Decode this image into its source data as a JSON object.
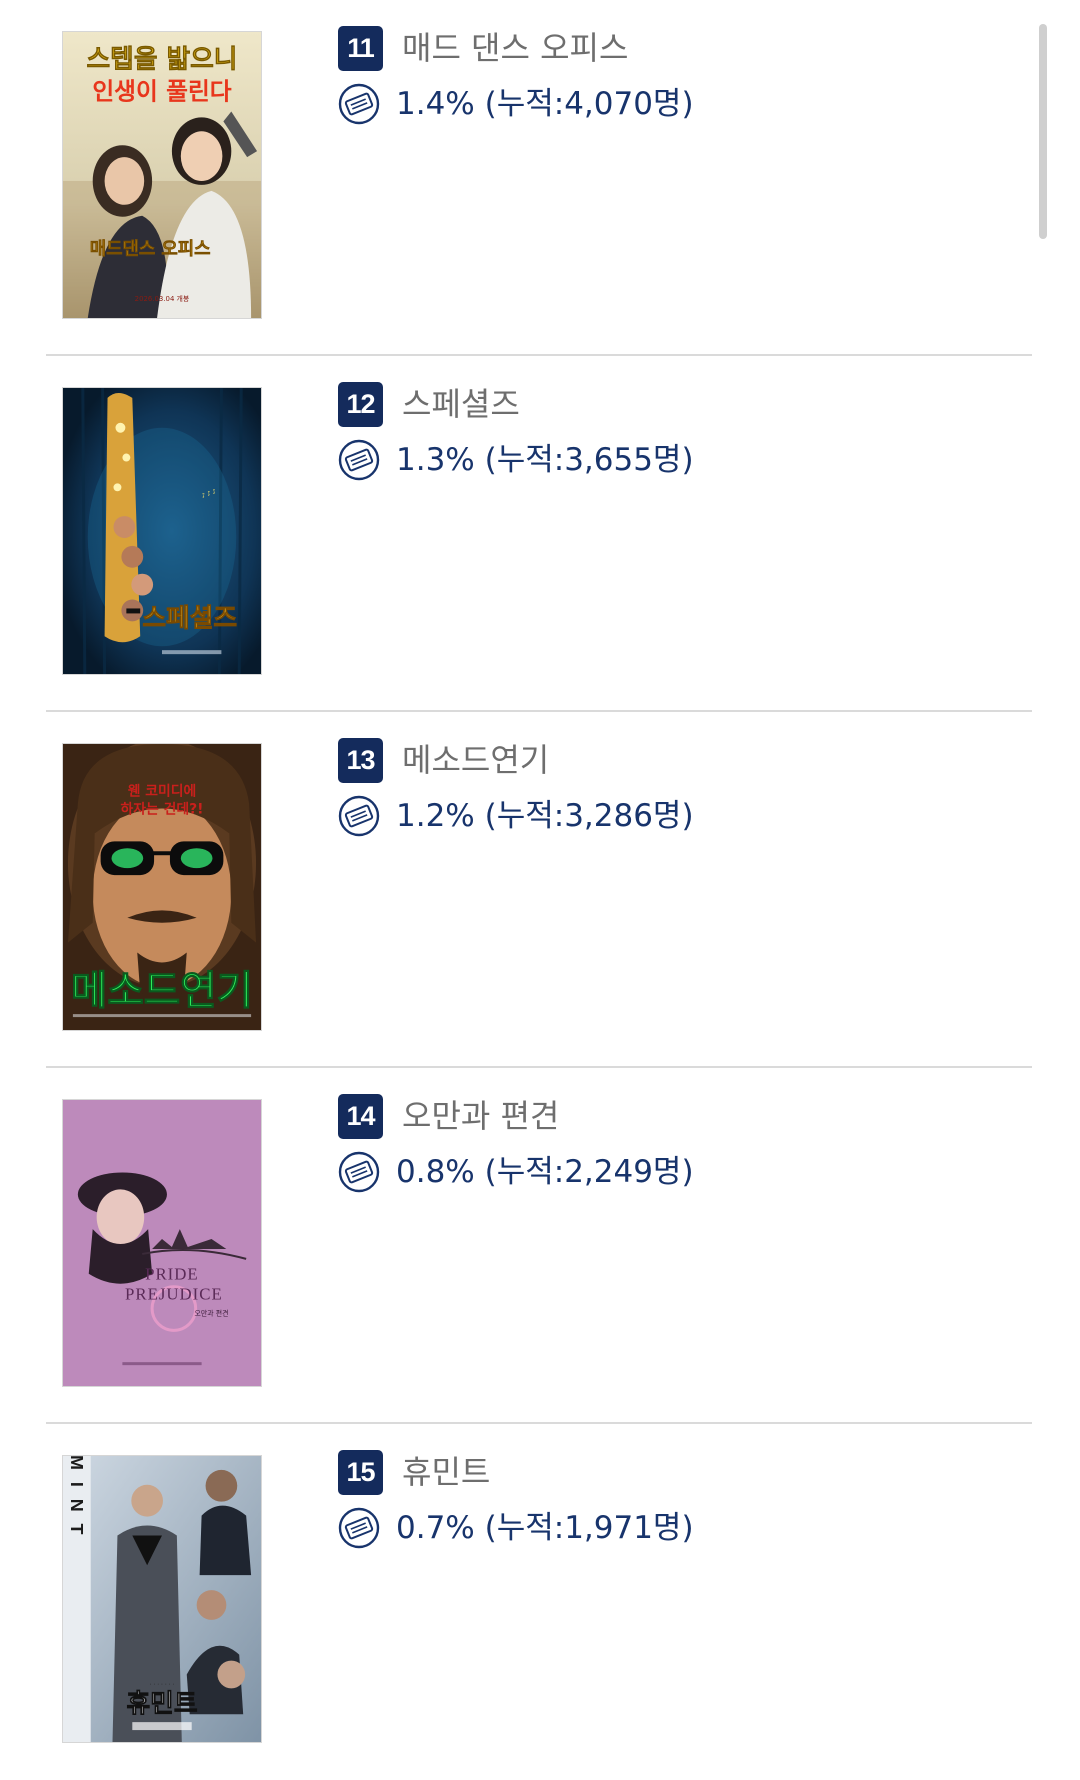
{
  "colors": {
    "rank_bg": "#142b5c",
    "title": "#6e6e6e",
    "stat": "#18346c",
    "divider": "#dadada"
  },
  "ticket_icon": "ticket-icon",
  "movies": [
    {
      "rank": "11",
      "title": "매드 댄스 오피스",
      "stat": "1.4% (누적:4,070명)",
      "poster": {
        "headline1": "스텝을 밟으니",
        "headline2": "인생이 풀린다",
        "logo": "매드댄스 오피스",
        "date": "2026.03.04 개봉"
      }
    },
    {
      "rank": "12",
      "title": "스페셜즈",
      "stat": "1.3% (누적:3,655명)",
      "poster": {
        "logo": "스페셜즈"
      }
    },
    {
      "rank": "13",
      "title": "메소드연기",
      "stat": "1.2% (누적:3,286명)",
      "poster": {
        "headline1": "웬 코미디에",
        "headline2": "하자는 건데?!",
        "logo": "메소드연기"
      }
    },
    {
      "rank": "14",
      "title": "오만과 편견",
      "stat": "0.8% (누적:2,249명)",
      "poster": {
        "logo1": "PRIDE",
        "logo2": "PREJUDICE",
        "subtitle": "오만과 편견"
      }
    },
    {
      "rank": "15",
      "title": "휴민트",
      "stat": "0.7% (누적:1,971명)",
      "poster": {
        "side": "HUMINT",
        "logo": "휴민트"
      }
    }
  ]
}
